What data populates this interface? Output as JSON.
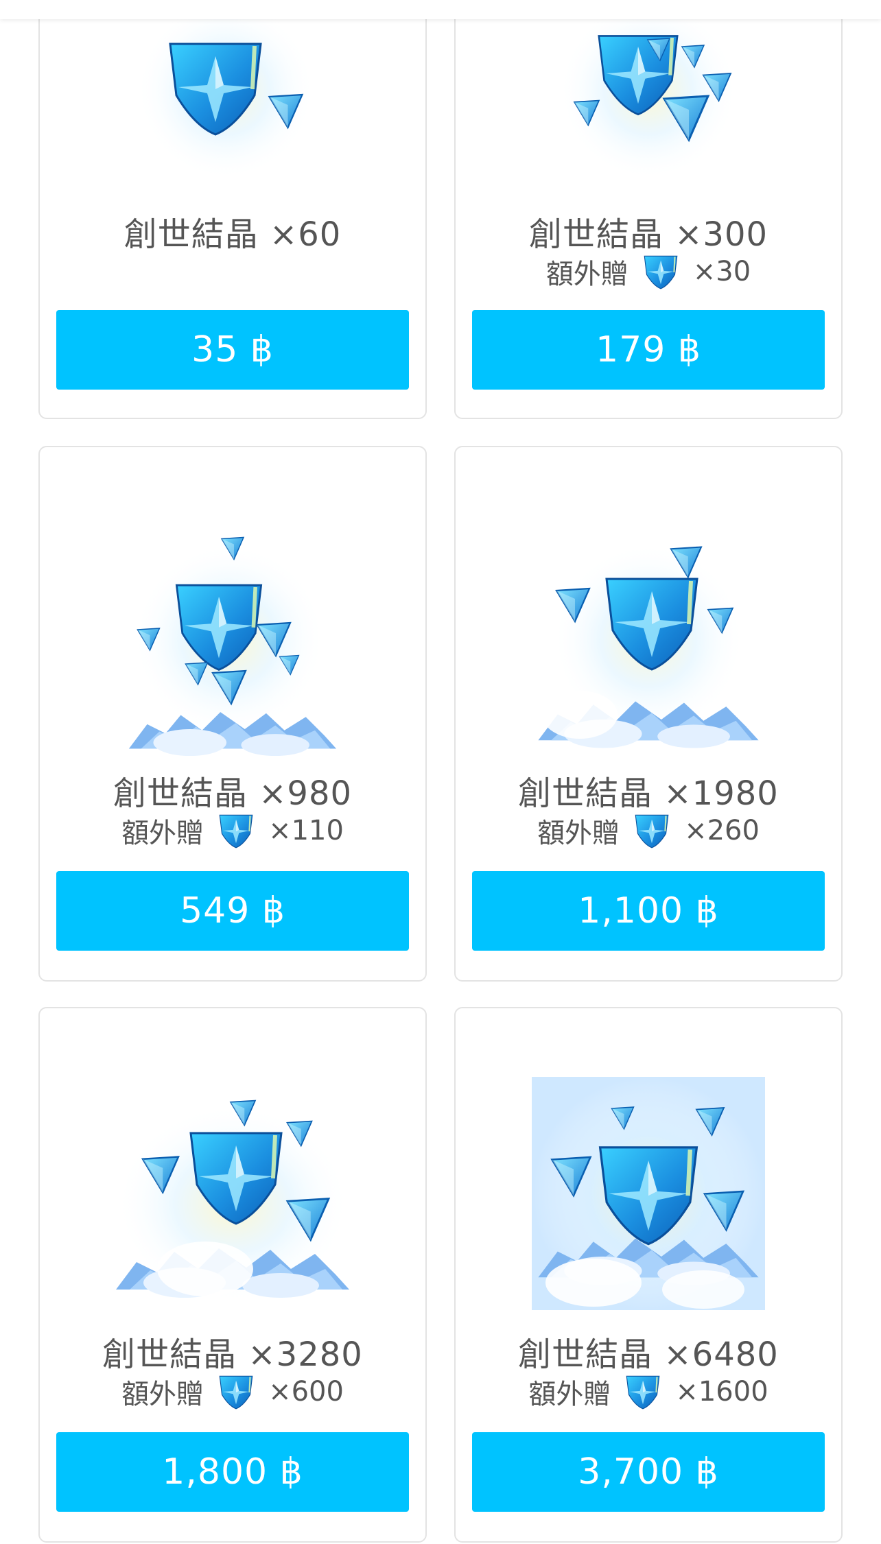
{
  "colors": {
    "accent": "#00c3ff",
    "text": "#555555",
    "border": "#e3e3e3"
  },
  "icons": {
    "bonus": "crystal-icon",
    "art": "genesis-crystal-icon"
  },
  "products": [
    {
      "title": "創世結晶 ×60",
      "bonus_label": "",
      "bonus_amount": "",
      "price": "35 ฿"
    },
    {
      "title": "創世結晶 ×300",
      "bonus_label": "額外贈",
      "bonus_amount": "×30",
      "price": "179 ฿"
    },
    {
      "title": "創世結晶 ×980",
      "bonus_label": "額外贈",
      "bonus_amount": "×110",
      "price": "549 ฿"
    },
    {
      "title": "創世結晶 ×1980",
      "bonus_label": "額外贈",
      "bonus_amount": "×260",
      "price": "1,100 ฿"
    },
    {
      "title": "創世結晶 ×3280",
      "bonus_label": "額外贈",
      "bonus_amount": "×600",
      "price": "1,800 ฿"
    },
    {
      "title": "創世結晶 ×6480",
      "bonus_label": "額外贈",
      "bonus_amount": "×1600",
      "price": "3,700 ฿"
    }
  ]
}
